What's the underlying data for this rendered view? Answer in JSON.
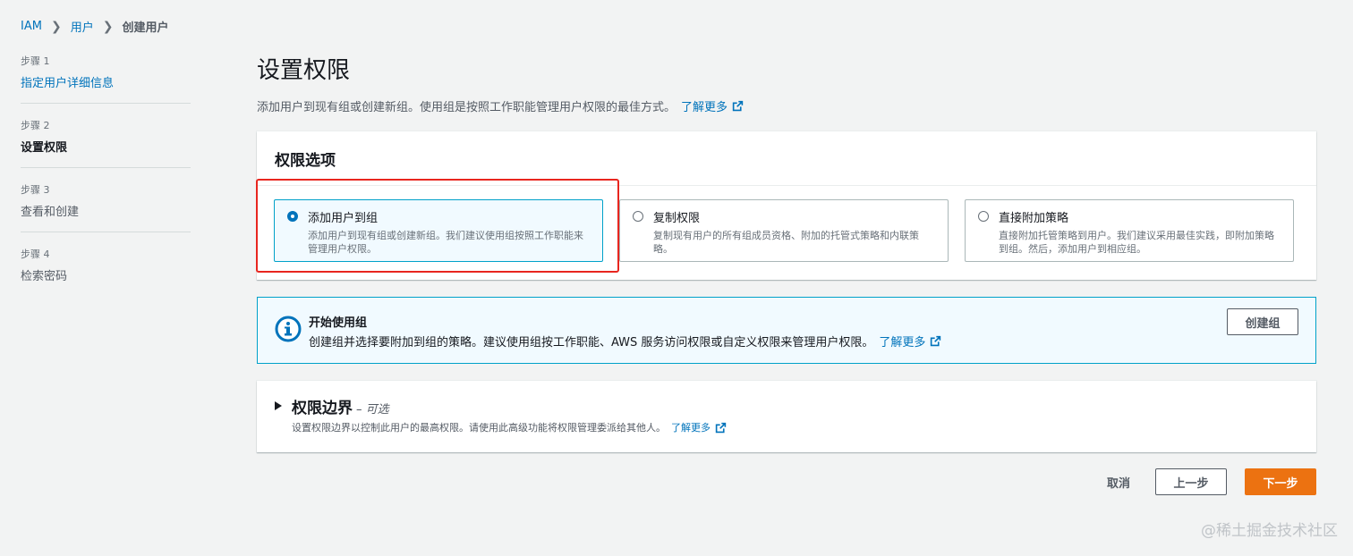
{
  "breadcrumb": {
    "root": "IAM",
    "parent": "用户",
    "current": "创建用户"
  },
  "steps": [
    {
      "num": "步骤 1",
      "title": "指定用户详细信息"
    },
    {
      "num": "步骤 2",
      "title": "设置权限"
    },
    {
      "num": "步骤 3",
      "title": "查看和创建"
    },
    {
      "num": "步骤 4",
      "title": "检索密码"
    }
  ],
  "page": {
    "title": "设置权限",
    "description": "添加用户到现有组或创建新组。使用组是按照工作职能管理用户权限的最佳方式。",
    "learn_more": "了解更多"
  },
  "permission_options": {
    "header": "权限选项",
    "options": [
      {
        "title": "添加用户到组",
        "desc": "添加用户到现有组或创建新组。我们建议使用组按照工作职能来管理用户权限。",
        "selected": true
      },
      {
        "title": "复制权限",
        "desc": "复制现有用户的所有组成员资格、附加的托管式策略和内联策略。",
        "selected": false
      },
      {
        "title": "直接附加策略",
        "desc": "直接附加托管策略到用户。我们建议采用最佳实践，即附加策略到组。然后，添加用户到相应组。",
        "selected": false
      }
    ]
  },
  "info": {
    "title": "开始使用组",
    "desc": "创建组并选择要附加到组的策略。建议使用组按工作职能、AWS 服务访问权限或自定义权限来管理用户权限。",
    "learn_more": "了解更多",
    "create_group_label": "创建组"
  },
  "boundary": {
    "title": "权限边界",
    "optional": "– 可选",
    "desc": "设置权限边界以控制此用户的最高权限。请使用此高级功能将权限管理委派给其他人。",
    "learn_more": "了解更多"
  },
  "footer": {
    "cancel": "取消",
    "prev": "上一步",
    "next": "下一步"
  },
  "watermark": "@稀土掘金技术社区",
  "colors": {
    "link": "#0073bb",
    "primary_button": "#ec7211",
    "selected_border": "#00a1c9",
    "highlight": "#e8261f"
  },
  "icons": {
    "external_link": "external-link-icon",
    "info": "info-icon",
    "caret": "caret-right-icon",
    "breadcrumb_sep": "chevron-right-icon"
  }
}
